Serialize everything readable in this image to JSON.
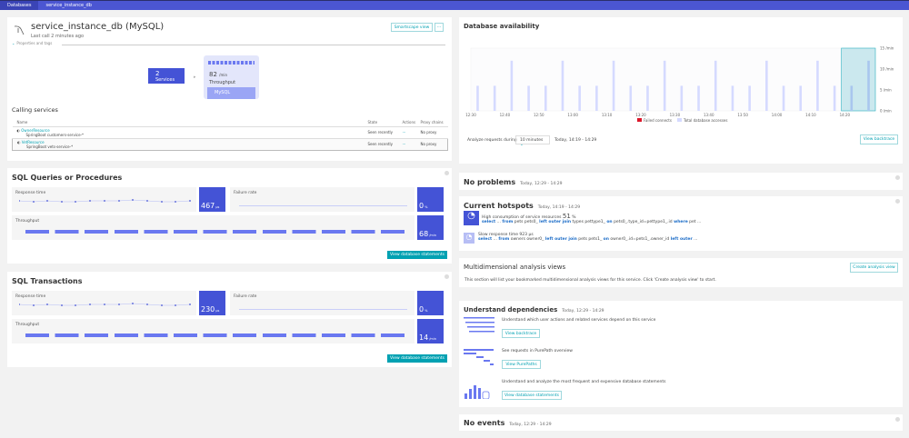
{
  "breadcrumb": [
    "Databases",
    "service_instance_db"
  ],
  "header": {
    "title": "service_instance_db (MySQL)",
    "subtitle": "Last call 2 minutes ago",
    "smartscape_label": "Smartscape view",
    "more_label": "···",
    "properties_label": "Properties and tags"
  },
  "flow": {
    "services_count": "2",
    "services_label": "Services",
    "throughput_value": "82",
    "throughput_unit": "/min",
    "throughput_label": "Throughput",
    "db_label": "MySQL"
  },
  "calling_services": {
    "title": "Calling services",
    "columns": [
      "Name",
      "State",
      "Actions",
      "Proxy chains"
    ],
    "rows": [
      {
        "name": "OwnerResource",
        "sub": "SpringBoot customers-service-*",
        "state": "Seen recently",
        "action": "···",
        "proxy": "No proxy"
      },
      {
        "name": "VetResource",
        "sub": "SpringBoot vets-service-*",
        "state": "Seen recently",
        "action": "···",
        "proxy": "No proxy"
      }
    ]
  },
  "sql_queries": {
    "title": "SQL Queries or Procedures",
    "response_label": "Response time",
    "response_value": "467",
    "response_unit": "µs",
    "failure_label": "Failure rate",
    "failure_value": "0",
    "failure_unit": "%",
    "throughput_label": "Throughput",
    "throughput_value": "68",
    "throughput_unit": "/min",
    "button": "View database statements"
  },
  "sql_transactions": {
    "title": "SQL Transactions",
    "response_label": "Response time",
    "response_value": "230",
    "response_unit": "µs",
    "failure_label": "Failure rate",
    "failure_value": "0",
    "failure_unit": "%",
    "throughput_label": "Throughput",
    "throughput_value": "14",
    "throughput_unit": "/min",
    "button": "View database statements"
  },
  "db_availability": {
    "title": "Database availability",
    "analyze_label": "Analyze requests during",
    "analyze_value": "10 minutes",
    "analyze_range": "Today, 14:19 - 14:29",
    "button": "View backtrace"
  },
  "chart_data": {
    "type": "bar",
    "x_ticks": [
      "12:30",
      "12:40",
      "12:50",
      "13:00",
      "13:10",
      "13:20",
      "13:30",
      "13:40",
      "13:50",
      "14:00",
      "14:10",
      "14:20"
    ],
    "y_ticks": [
      "0 /min",
      "5 /min",
      "10 /min",
      "15 /min"
    ],
    "ylim": [
      0,
      15
    ],
    "xlim": [
      "12:30",
      "14:29"
    ],
    "x": [
      "12:32",
      "12:37",
      "12:42",
      "12:47",
      "12:52",
      "12:57",
      "13:02",
      "13:07",
      "13:12",
      "13:17",
      "13:22",
      "13:27",
      "13:32",
      "13:37",
      "13:42",
      "13:47",
      "13:52",
      "13:57",
      "14:02",
      "14:07",
      "14:12",
      "14:17",
      "14:22",
      "14:27"
    ],
    "series": [
      {
        "name": "Total database accesses",
        "color": "#d5daff",
        "values": [
          6,
          6,
          12,
          6,
          6,
          12,
          6,
          6,
          12,
          6,
          6,
          12,
          6,
          6,
          12,
          6,
          6,
          12,
          6,
          6,
          12,
          6,
          6,
          12
        ]
      },
      {
        "name": "Failed connects",
        "color": "#dc172a",
        "values": [
          0,
          0,
          0,
          0,
          0,
          0,
          0,
          0,
          0,
          0,
          0,
          0,
          0,
          0,
          0,
          0,
          0,
          0,
          0,
          0,
          0,
          0,
          0,
          0
        ]
      }
    ],
    "selection": [
      "14:19",
      "14:29"
    ],
    "legend": "bottom"
  },
  "problems": {
    "title": "No problems",
    "range": "Today, 12:29 - 14:29"
  },
  "hotspots": {
    "title": "Current hotspots",
    "range": "Today, 14:19 - 14:29",
    "items": [
      {
        "text": "High consumption of service resources",
        "value": "51",
        "unit": "%",
        "sql": [
          [
            "select",
            "kw"
          ],
          " ... ",
          [
            "from",
            "kw"
          ],
          " pets pets0_ ",
          [
            "left outer join",
            "kw"
          ],
          " types pettype1_ ",
          [
            "on",
            "kw"
          ],
          " pets0_.type_id=pettype1_.id ",
          [
            "where",
            "kw"
          ],
          " pet ..."
        ]
      },
      {
        "text": "Slow response time 923 µs",
        "sql": [
          [
            "select",
            "kw"
          ],
          " ... ",
          [
            "from",
            "kw"
          ],
          " owners owner0_ ",
          [
            "left outer join",
            "kw"
          ],
          " pets pets1_ ",
          [
            "on",
            "kw"
          ],
          " owner0_.id=pets1_.owner_id ",
          [
            "left outer",
            "kw"
          ],
          " ..."
        ]
      }
    ]
  },
  "analysis": {
    "title": "Multidimensional analysis views",
    "text": "This section will list your bookmarked multidimensional analysis views for this service. Click 'Create analysis view' to start.",
    "button": "Create analysis view"
  },
  "dependencies": {
    "title": "Understand dependencies",
    "range": "Today, 12:29 - 14:29",
    "items": [
      {
        "text": "Understand which user actions and related services depend on this service",
        "button": "View backtrace"
      },
      {
        "text": "See requests in PurePath overview",
        "button": "View PurePaths"
      },
      {
        "text": "Understand and analyze the most frequent and expensive database statements",
        "button": "View database statements"
      }
    ]
  },
  "events": {
    "title": "No events",
    "range": "Today, 12:29 - 14:29"
  }
}
